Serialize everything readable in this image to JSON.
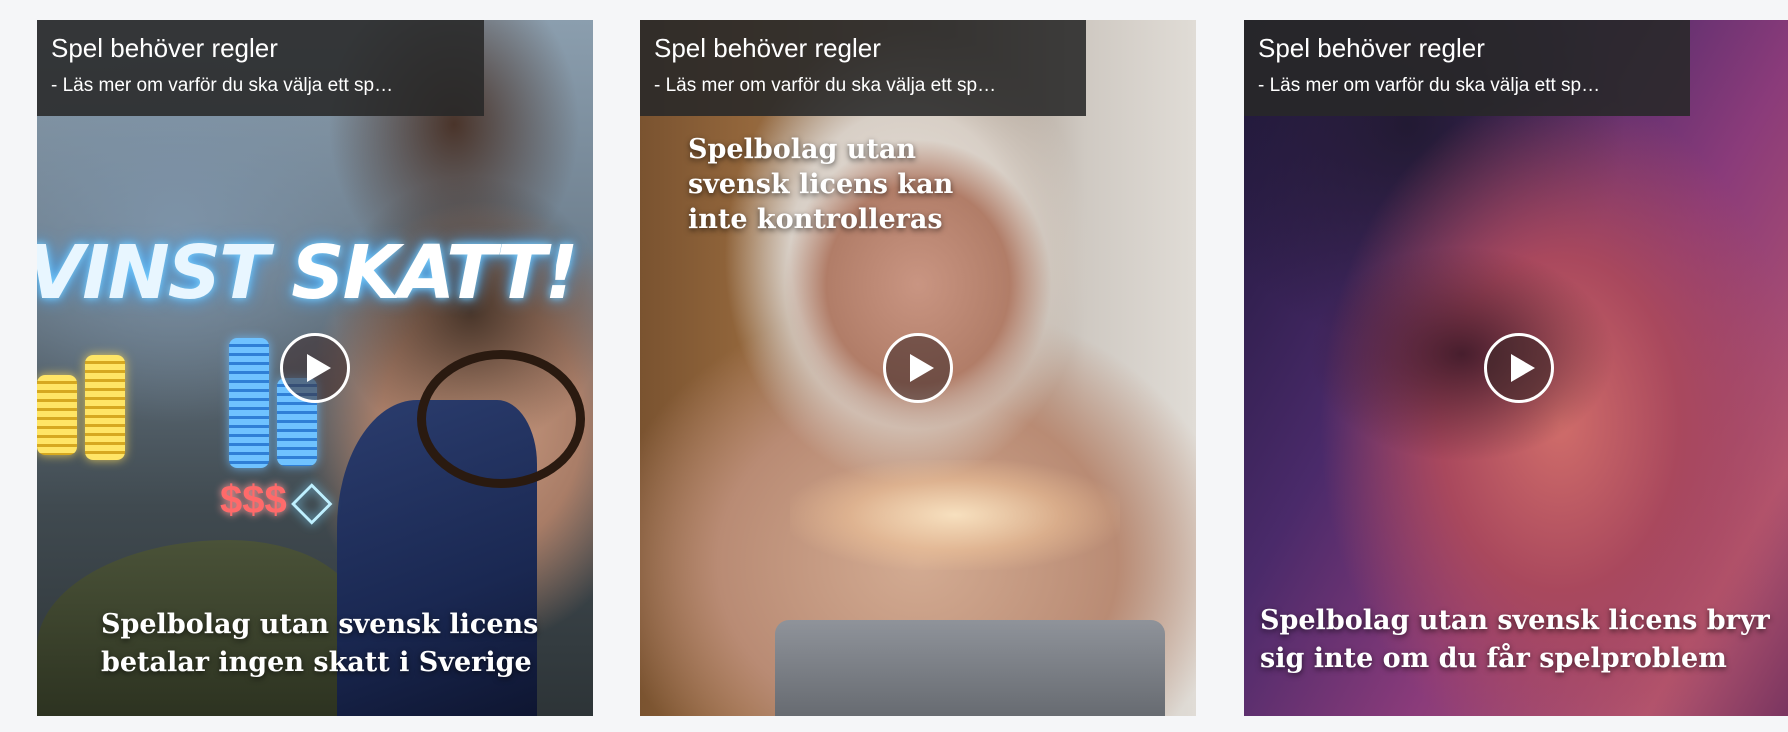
{
  "cards": [
    {
      "title": "Spel behöver regler",
      "subtitle": "- Läs mer om varför du ska välja ett sp…",
      "caption_lines": [
        "Spelbolag utan svensk licens",
        "betalar ingen skatt i Sverige"
      ],
      "graphic_text": {
        "word1": "VINST",
        "word2": "SKATT!"
      },
      "graphic_symbols": {
        "dollars": "$$$",
        "gem": "◇"
      }
    },
    {
      "title": "Spel behöver regler",
      "subtitle": "- Läs mer om varför du ska välja ett sp…",
      "caption_lines": [
        "Spelbolag utan",
        "svensk licens kan",
        "inte kontrolleras"
      ]
    },
    {
      "title": "Spel behöver regler",
      "subtitle": "- Läs mer om varför du ska välja ett sp…",
      "caption_lines": [
        "Spelbolag utan svensk licens bryr",
        "sig inte om du får spelproblem"
      ]
    }
  ],
  "icons": {
    "play": "play-icon"
  },
  "colors": {
    "page_background": "#f5f6f8",
    "overlay": "#282828",
    "text": "#ffffff"
  }
}
